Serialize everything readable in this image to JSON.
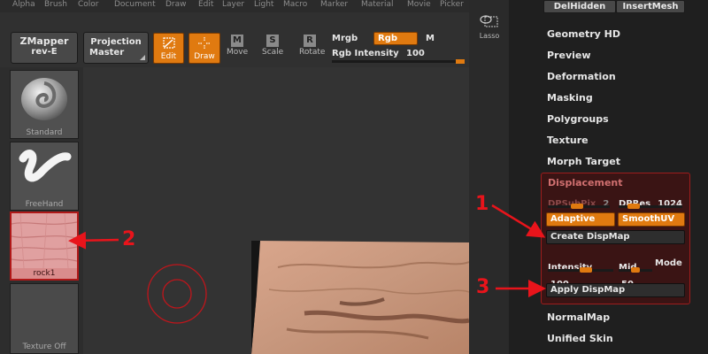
{
  "menubar": [
    "Alpha",
    "Brush",
    "Color",
    "Document",
    "Draw",
    "Edit",
    "Layer",
    "Light",
    "Macro",
    "Marker",
    "Material",
    "Movie",
    "Picker"
  ],
  "toolbar": {
    "zmapper_line1": "ZMapper",
    "zmapper_line2": "rev-E",
    "projection_line1": "Projection",
    "projection_line2": "Master",
    "edit": "Edit",
    "draw": "Draw",
    "move": "Move",
    "move_glyph": "M",
    "scale": "Scale",
    "scale_glyph": "S",
    "rotate": "Rotate",
    "rotate_glyph": "R",
    "mrgb": "Mrgb",
    "rgb": "Rgb",
    "m": "M",
    "rgb_intensity_label": "Rgb Intensity",
    "rgb_intensity_value": "100",
    "lasso": "Lasso"
  },
  "brushes": [
    {
      "name": "Standard"
    },
    {
      "name": "FreeHand"
    },
    {
      "name": "rock1"
    },
    {
      "name": "Texture Off"
    }
  ],
  "right_panel": {
    "del_hidden": "DelHidden",
    "insert_mesh": "InsertMesh",
    "items_top": [
      "Geometry HD",
      "Preview",
      "Deformation",
      "Masking",
      "Polygroups",
      "Texture",
      "Morph Target"
    ],
    "displacement": {
      "title": "Displacement",
      "dpsubpix_label": "DPSubPix",
      "dpsubpix_value": "2",
      "dpres_label": "DPRes",
      "dpres_value": "1024",
      "adaptive": "Adaptive",
      "smooth_uv": "SmoothUV",
      "create_dispmap": "Create DispMap",
      "intensity_label": "Intensity",
      "intensity_value": "100",
      "mid_label": "Mid",
      "mid_value": "50",
      "mode": "Mode",
      "apply_dispmap": "Apply DispMap"
    },
    "items_bottom": [
      "NormalMap",
      "Unified Skin"
    ]
  },
  "annotations": [
    "1",
    "2",
    "3"
  ],
  "colors": {
    "accent": "#e07a10",
    "highlight": "#e8141b"
  }
}
